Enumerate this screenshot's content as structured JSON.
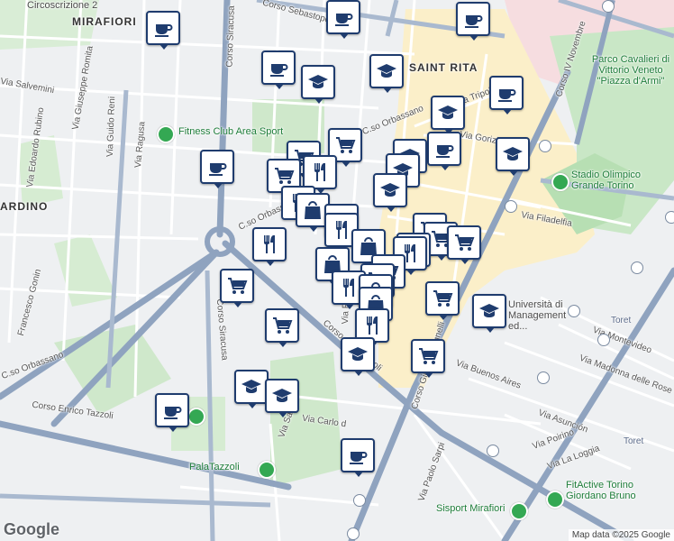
{
  "labels": {
    "circoscrizione": "Circoscrizione 2",
    "mirafiori": "MIRAFIORI",
    "saint_rita": "SAINT RITA",
    "ardino": "ARDINO",
    "corso_sebastopoli": "Corso Sebastopoli",
    "via_salvemini": "Via Salvemini",
    "via_giuseppe_romita": "Via Giuseppe Romita",
    "via_guido_reni": "Via Guido Reni",
    "via_edoardo_rubino": "Via Edoardo Rubino",
    "via_ragusa": "Via Ragusa",
    "fitness_club": "Fitness Club Area Sport",
    "corso_siracusa_top": "Corso Siracusa",
    "corso_orbassano_mid": "C.so Orbassano",
    "corso_orbassano_top": "C.so Orbassano",
    "via_tripoli": "Via Tripoli",
    "via_gorizia": "Via Gorizia",
    "via_filadelfia": "Via Filadelfia",
    "corso_iv_novembre": "Corso IV Novembre",
    "parco_cavalieri": "Parco Cavalieri di Vittorio Veneto \"Piazza d'Armi\"",
    "stadio_olimpico": "Stadio Olimpico Grande Torino",
    "universita": "Università di Management ed...",
    "via_montevideo": "Via Montevideo",
    "via_madonna": "Via Madonna delle Rose",
    "via_buenos_aires": "Via Buenos Aires",
    "via_asuncion": "Via Asunción",
    "via_poirino": "Via Poirino",
    "via_la_loggia": "Via La Loggia",
    "francesco_gonin": "Francesco Gonin",
    "corso_orbassano_left": "C.so Orbassano",
    "corso_enrico_tazzoli": "Corso Enrico Tazzoli",
    "corso_siracusa_low": "Corso Siracusa",
    "corso_sebastopoli_low": "Corso Sebastopoli",
    "corso_giovanni_agnelli": "Corso Giovanni Agnelli",
    "via_santa": "Via Sant",
    "via_carlo": "Via Carlo d",
    "via_paolo_sarpi": "Via Paolo Sarpi",
    "palatazzoli": "PalaTazzoli",
    "sisport": "Sisport Mirafiori",
    "fitactive": "FitActive Torino Giordano Bruno",
    "toret1": "Toret",
    "toret2": "Toret",
    "via_p": "Via P",
    "via_e": "Via E"
  },
  "icons": {
    "cafe": "coffee-cup",
    "school": "graduation-cap",
    "shop": "shopping-cart",
    "restaurant": "fork-knife",
    "store": "shopping-bag"
  },
  "colors": {
    "pin_border": "#1f3c6e",
    "park": "#c9e7c6",
    "highlight_zone": "#fbefc9",
    "major_road": "#8fa3bf"
  },
  "attribution": "Map data ©2025 Google",
  "logo": "Google"
}
